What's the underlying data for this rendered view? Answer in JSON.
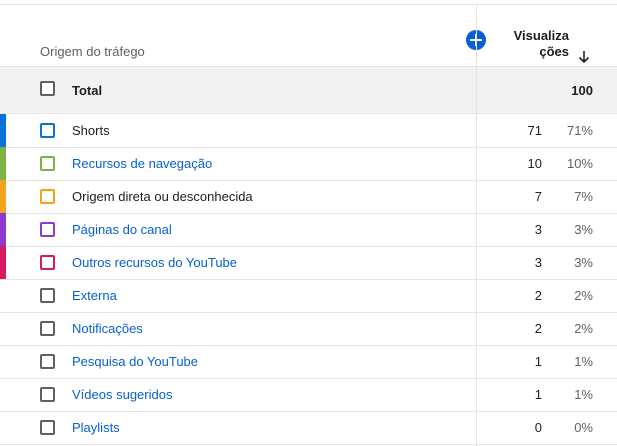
{
  "header": {
    "source_label": "Origem do tráfego",
    "views_label_line1": "Visualiza",
    "views_label_line2": "ções",
    "add_icon": "plus-icon",
    "sort_icon": "arrow-down-icon"
  },
  "total": {
    "label": "Total",
    "value": "100"
  },
  "rows": [
    {
      "label": "Shorts",
      "value": "71",
      "pct": "71%",
      "color": "#0a73d9",
      "link": false
    },
    {
      "label": "Recursos de navegação",
      "value": "10",
      "pct": "10%",
      "color": "#7cb342",
      "link": true
    },
    {
      "label": "Origem direta ou desconhecida",
      "value": "7",
      "pct": "7%",
      "color": "#f4a21e",
      "link": false
    },
    {
      "label": "Páginas do canal",
      "value": "3",
      "pct": "3%",
      "color": "#8e3ad0",
      "link": true
    },
    {
      "label": "Outros recursos do YouTube",
      "value": "3",
      "pct": "3%",
      "color": "#d81b60",
      "link": true
    },
    {
      "label": "Externa",
      "value": "2",
      "pct": "2%",
      "color": "",
      "link": true
    },
    {
      "label": "Notificações",
      "value": "2",
      "pct": "2%",
      "color": "",
      "link": true
    },
    {
      "label": "Pesquisa do YouTube",
      "value": "1",
      "pct": "1%",
      "color": "",
      "link": true
    },
    {
      "label": "Vídeos sugeridos",
      "value": "1",
      "pct": "1%",
      "color": "",
      "link": true
    },
    {
      "label": "Playlists",
      "value": "0",
      "pct": "0%",
      "color": "",
      "link": true
    }
  ]
}
